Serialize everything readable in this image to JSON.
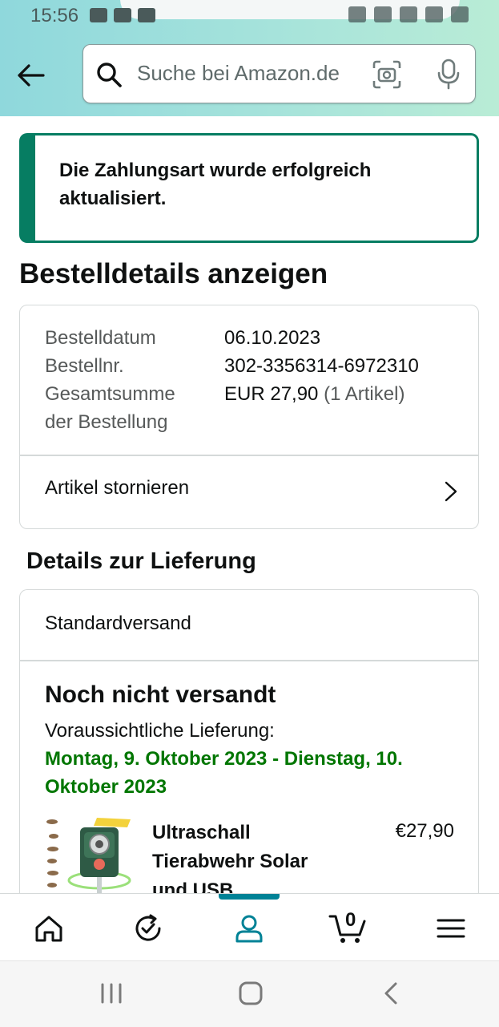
{
  "status_bar": {
    "time": "15:56"
  },
  "search": {
    "placeholder": "Suche bei Amazon.de"
  },
  "alert": {
    "message": "Die Zahlungsart wurde erfolgreich aktualisiert."
  },
  "page_title": "Bestelldetails anzeigen",
  "order": {
    "date_label": "Bestelldatum",
    "date_value": "06.10.2023",
    "number_label": "Bestellnr.",
    "number_value": "302-3356314-6972310",
    "total_label_1": "Gesamtsumme",
    "total_label_2": "der Bestellung",
    "total_value": "EUR 27,90",
    "total_items": "(1 Artikel)",
    "cancel_label": "Artikel stornieren"
  },
  "delivery": {
    "section_title": "Details zur Lieferung",
    "method": "Standardversand",
    "status": "Noch nicht versandt",
    "eta_label": "Voraussichtliche Lieferung:",
    "eta_value": "Montag, 9. Oktober 2023 - Dienstag, 10. Oktober 2023"
  },
  "product": {
    "title": "Ultraschall Tierabwehr Solar und USB",
    "price": "€27,90"
  },
  "bottom_nav": {
    "cart_count": "0"
  },
  "colors": {
    "accent": "#008296",
    "success": "#067d62",
    "eta": "#007600"
  }
}
